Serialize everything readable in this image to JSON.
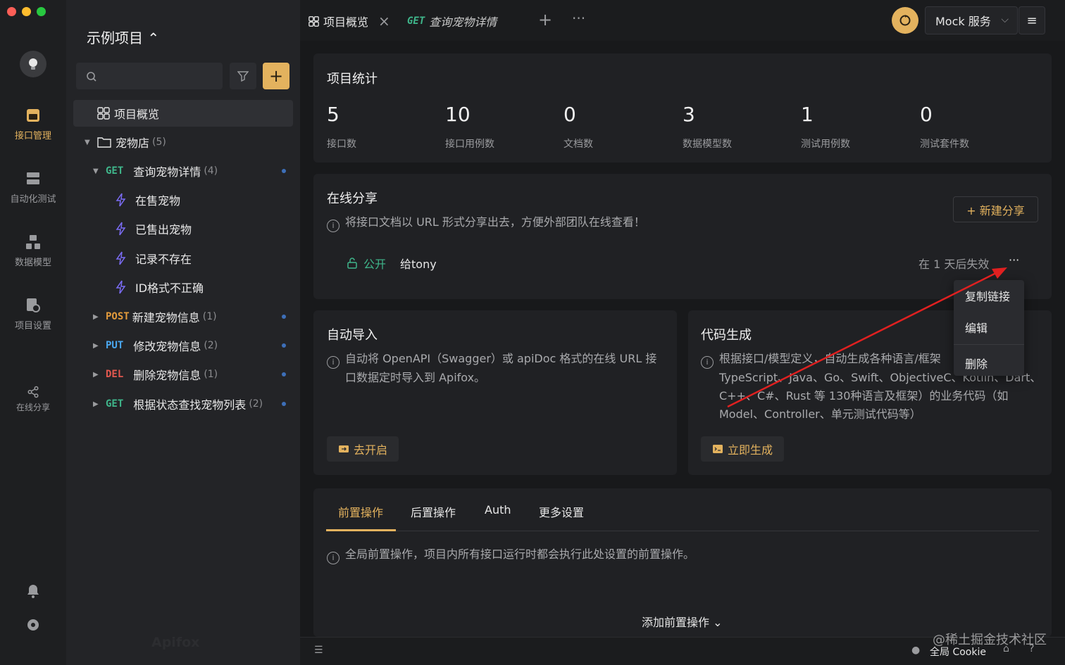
{
  "project": {
    "title": "示例项目 ⌃"
  },
  "rail": {
    "items": [
      {
        "label": "接口管理"
      },
      {
        "label": "自动化测试"
      },
      {
        "label": "数据模型"
      },
      {
        "label": "项目设置"
      },
      {
        "label": "在线分享"
      }
    ],
    "logo": "Apifox"
  },
  "tree": {
    "overview": "项目概览",
    "folder": {
      "label": "宠物店",
      "count": "(5)"
    },
    "apis": [
      {
        "method": "GET",
        "label": "查询宠物详情",
        "count": "(4)"
      },
      {
        "method": "POST",
        "label": "新建宠物信息",
        "count": "(1)"
      },
      {
        "method": "PUT",
        "label": "修改宠物信息",
        "count": "(2)"
      },
      {
        "method": "DEL",
        "label": "删除宠物信息",
        "count": "(1)"
      },
      {
        "method": "GET",
        "label": "根据状态查找宠物列表",
        "count": "(2)"
      }
    ],
    "cases": [
      "在售宠物",
      "已售出宠物",
      "记录不存在",
      "ID格式不正确"
    ]
  },
  "tabs": {
    "tab1": "项目概览",
    "tab2_method": "GET",
    "tab2_label": "查询宠物详情",
    "plus": "+",
    "more": "···"
  },
  "topright": {
    "mock": "Mock 服务"
  },
  "stats": {
    "title": "项目统计",
    "items": [
      {
        "value": "5",
        "label": "接口数"
      },
      {
        "value": "10",
        "label": "接口用例数"
      },
      {
        "value": "0",
        "label": "文档数"
      },
      {
        "value": "3",
        "label": "数据模型数"
      },
      {
        "value": "1",
        "label": "测试用例数"
      },
      {
        "value": "0",
        "label": "测试套件数"
      }
    ]
  },
  "share": {
    "title": "在线分享",
    "desc": "将接口文档以 URL 形式分享出去，方便外部团队在线查看！",
    "new_btn": "+ 新建分享",
    "row": {
      "visibility": "公开",
      "to": "给tony",
      "expire": "在 1 天后失效",
      "more": "···"
    },
    "menu": [
      "复制链接",
      "编辑",
      "删除"
    ]
  },
  "import": {
    "title": "自动导入",
    "desc1": "自动将 OpenAPI（Swagger）或 apiDoc 格式的在线 URL 接",
    "desc2": "口数据定时导入到 Apifox。",
    "btn": "去开启"
  },
  "codegen": {
    "title": "代码生成",
    "desc1": "根据接口/模型定义，自动生成各种语言/框架",
    "desc2": "TypeScript、Java、Go、Swift、ObjectiveC、Kotlin、Dart、",
    "desc3": "C++、C#、Rust 等 130种语言及框架）的业务代码（如",
    "desc4": "Model、Controller、单元测试代码等）",
    "btn": "立即生成"
  },
  "lower": {
    "tabs": [
      "前置操作",
      "后置操作",
      "Auth",
      "更多设置"
    ],
    "desc": "全局前置操作，项目内所有接口运行时都会执行此处设置的前置操作。",
    "add": "添加前置操作 ⌄"
  },
  "status": {
    "cookie": "全局 Cookie",
    "watermark": "@稀土掘金技术社区"
  },
  "colors": {
    "accent": "#e3b25e",
    "get": "#3fb68b",
    "post": "#e39b3c",
    "put": "#4aa8f0",
    "del": "#e3584f",
    "annotation": "#e02020"
  }
}
